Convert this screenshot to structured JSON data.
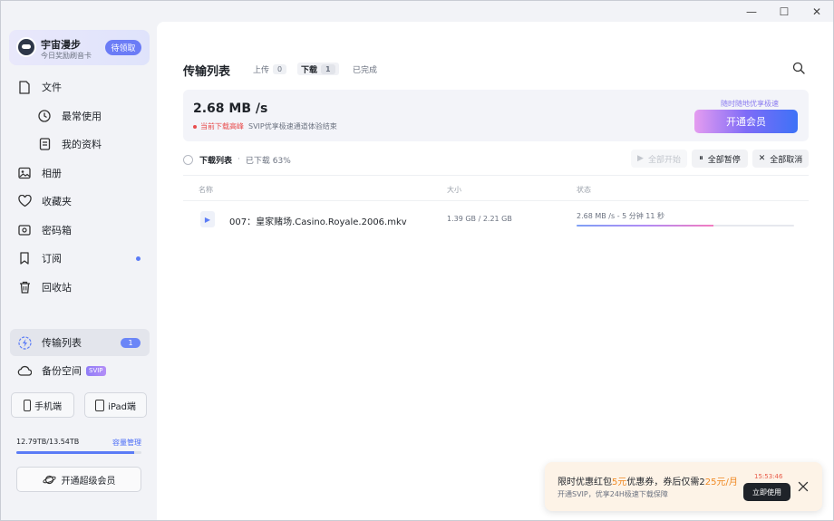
{
  "window": {
    "minimize": "—",
    "maximize": "☐",
    "close": "✕"
  },
  "sidebar": {
    "promo": {
      "title": "宇宙漫步",
      "subtitle": "今日奖励刷音卡",
      "button": "待领取"
    },
    "items": [
      {
        "label": "文件",
        "icon": "file-icon"
      },
      {
        "label": "最常使用",
        "icon": "clock-icon"
      },
      {
        "label": "我的资料",
        "icon": "document-icon"
      },
      {
        "label": "相册",
        "icon": "photo-icon"
      },
      {
        "label": "收藏夹",
        "icon": "heart-icon"
      },
      {
        "label": "密码箱",
        "icon": "safe-icon"
      },
      {
        "label": "订阅",
        "icon": "bookmark-icon"
      },
      {
        "label": "回收站",
        "icon": "trash-icon"
      }
    ],
    "transfer": {
      "label": "传输列表",
      "count": "1"
    },
    "backup": {
      "label": "备份空间",
      "tag": "SVIP"
    },
    "devices": {
      "phone": "手机端",
      "ipad": "iPad端"
    },
    "storage": {
      "used_text": "12.79TB/13.54TB",
      "manage": "容量管理",
      "fraction": 0.945
    },
    "vip_button": "开通超级会员"
  },
  "main": {
    "title": "传输列表",
    "tabs": [
      {
        "label": "上传",
        "count": "0"
      },
      {
        "label": "下载",
        "count": "1"
      },
      {
        "label": "已完成",
        "count": ""
      }
    ],
    "speed": {
      "value": "2.68 MB /s",
      "warn_red": "当前下载高峰",
      "warn_text": "SVIP优享极速通道体验结束",
      "hint": "随时随地优享极速",
      "button": "开通会员"
    },
    "list": {
      "title": "下载列表",
      "sep": "·",
      "progress": "已下载 63%",
      "actions": {
        "start_all": "全部开始",
        "pause_all": "全部暂停",
        "cancel_all": "全部取消"
      }
    },
    "columns": {
      "name": "名称",
      "size": "大小",
      "status": "状态"
    },
    "files": [
      {
        "name": "007：皇家赌场.Casino.Royale.2006.mkv",
        "size": "1.39 GB / 2.21 GB",
        "status": "2.68 MB /s - 5 分钟 11 秒",
        "progress": 0.63
      }
    ]
  },
  "toast": {
    "main_1": "限时优惠红包",
    "main_hl1": "5元",
    "main_2": "优惠券，券后仅需2",
    "main_hl2": "25元/月",
    "sub": "开通SVIP，优享24H极速下载保障",
    "timer": "15:53:46",
    "button": "立即使用"
  }
}
